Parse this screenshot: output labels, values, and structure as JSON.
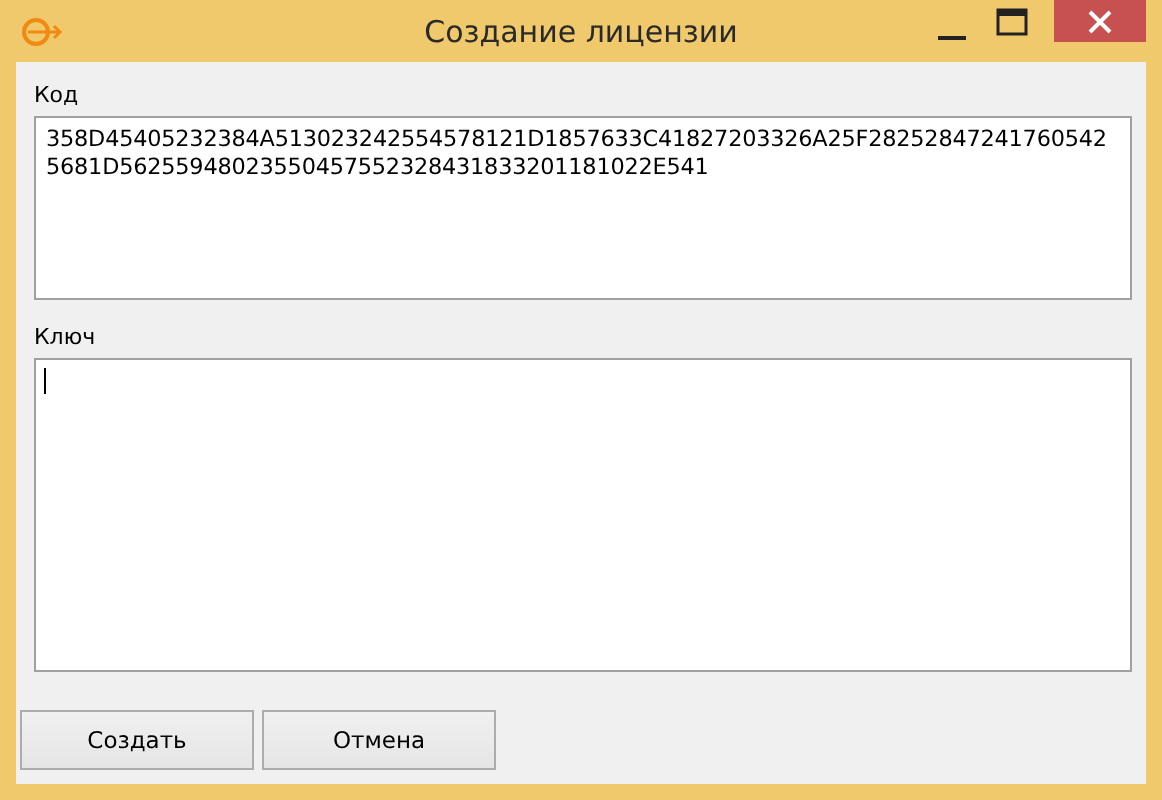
{
  "window": {
    "title": "Создание лицензии"
  },
  "code": {
    "label": "Код",
    "value": "358D45405232384A513023242554578121D1857633C41827203326A25F282528472417605425681D56255948023550457552328431833201181022E541"
  },
  "key": {
    "label": "Ключ",
    "focused": true
  },
  "buttons": [
    {
      "label": "Создать"
    },
    {
      "label": "Отмена"
    }
  ]
}
